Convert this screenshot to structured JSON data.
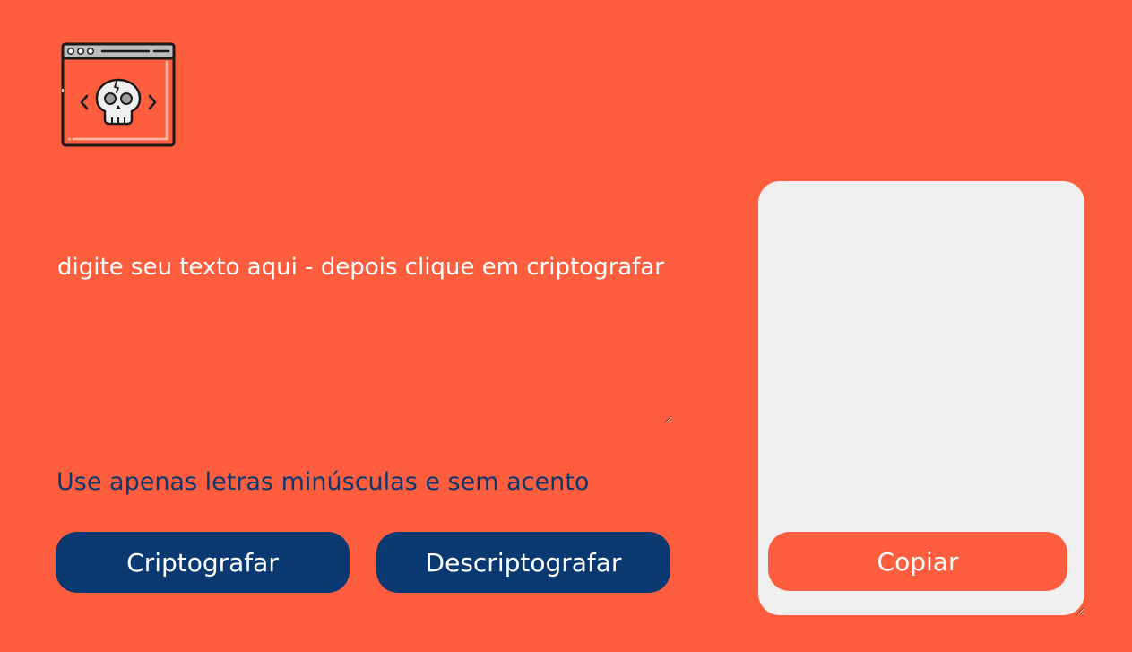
{
  "logo": {
    "icon": "browser-window-skull-icon"
  },
  "input": {
    "placeholder": "digite seu texto aqui - depois clique em criptografar",
    "value": ""
  },
  "hint": {
    "text": "Use apenas letras minúsculas e sem acento"
  },
  "buttons": {
    "encrypt_label": "Criptografar",
    "decrypt_label": "Descriptografar",
    "copy_label": "Copiar"
  },
  "output": {
    "value": ""
  },
  "colors": {
    "background": "#FF5E3E",
    "primary_button": "#0A3871",
    "output_panel": "#EFEFEF",
    "hint_text": "#0A3871",
    "button_text": "#FFFFFF"
  }
}
